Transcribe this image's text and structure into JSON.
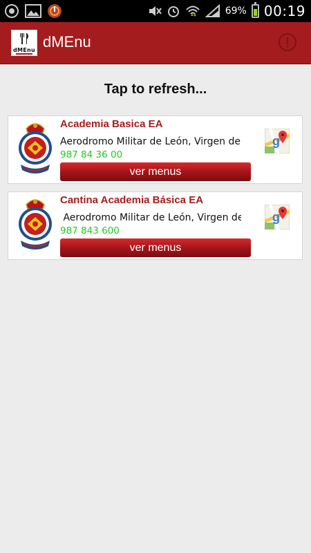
{
  "status_bar": {
    "battery_percent": "69%",
    "battery_level": 0.69,
    "time": "00:19",
    "icons": [
      "sync-icon",
      "gallery-icon",
      "app-notification-icon",
      "mute-icon",
      "alarm-icon",
      "wifi-icon",
      "signal-icon",
      "battery-icon"
    ]
  },
  "action_bar": {
    "logo_text": "dMEnu",
    "title": "dMEnu",
    "color": "#a51c1e"
  },
  "refresh_label": "Tap to refresh...",
  "restaurants": [
    {
      "name": "Academia Basica EA",
      "address": "Aerodromo Militar de León, Virgen del",
      "phone": "987 84 36 00",
      "button_label": "ver menus"
    },
    {
      "name": "Cantina Academia Básica EA",
      "address": " Aerodromo Militar de León, Virgen del",
      "phone": "987 843 600",
      "button_label": "ver menus"
    }
  ],
  "colors": {
    "accent": "#a51c1e",
    "phone": "#24c924",
    "background": "#ececec"
  }
}
